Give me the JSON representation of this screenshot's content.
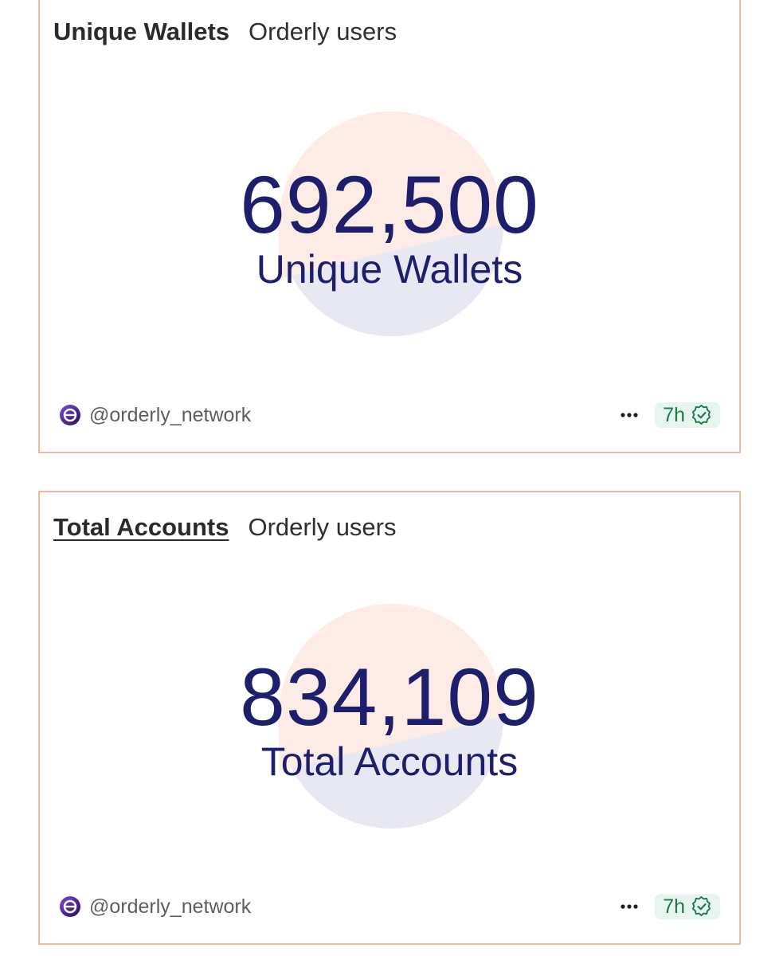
{
  "cards": [
    {
      "tabs": [
        {
          "label": "Unique Wallets"
        },
        {
          "label": "Orderly users"
        }
      ],
      "counter": {
        "value": "692,500",
        "label": "Unique Wallets"
      },
      "footer": {
        "creator": "@orderly_network",
        "freshness": "7h"
      }
    },
    {
      "tabs": [
        {
          "label": "Total Accounts"
        },
        {
          "label": "Orderly users"
        }
      ],
      "counter": {
        "value": "834,109",
        "label": "Total Accounts"
      },
      "footer": {
        "creator": "@orderly_network",
        "freshness": "7h"
      }
    }
  ],
  "colors": {
    "card_border": "#f2b8a6",
    "counter_text": "#1d1f6d",
    "circle_top": "#fdece6",
    "circle_bottom": "#e8e8f2",
    "freshness_bg": "#e6f6ee",
    "freshness_text": "#1f7a4a"
  },
  "icons": [
    "orderly-avatar-icon",
    "more-dots-icon",
    "verified-check-icon"
  ]
}
